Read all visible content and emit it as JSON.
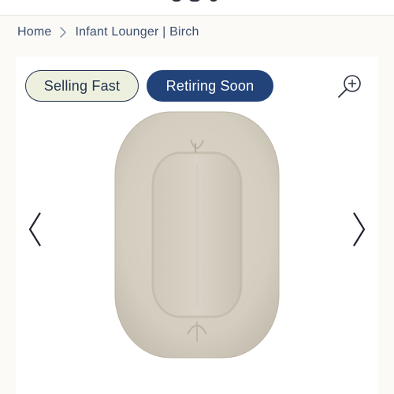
{
  "breadcrumb": {
    "home_label": "Home",
    "separator_icon": "chevron-right-icon",
    "current_label": "Infant Lounger | Birch"
  },
  "badges": {
    "selling_fast": "Selling Fast",
    "retiring_soon": "Retiring Soon"
  },
  "gallery": {
    "zoom_icon": "zoom-in-icon",
    "prev_icon": "chevron-left-icon",
    "next_icon": "chevron-right-icon",
    "image_subject": "infant-lounger-birch"
  },
  "colors": {
    "breadcrumb_text": "#3b4f6e",
    "badge_outline": "#22344f",
    "badge_selling_bg": "#eef0df",
    "badge_retiring_bg": "#22427a",
    "lounger_fabric": "#d6d0c3"
  }
}
